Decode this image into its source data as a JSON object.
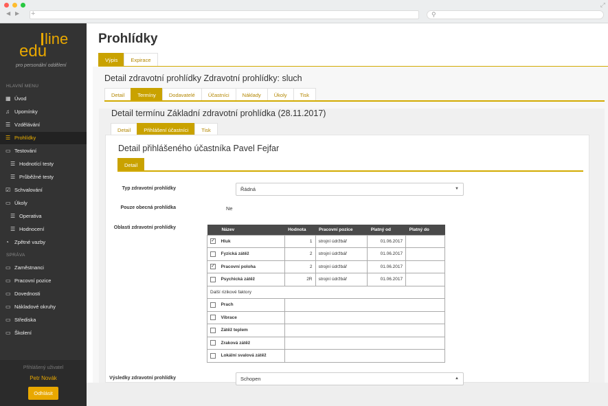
{
  "browser": {
    "nav_back": "◀",
    "nav_fwd": "▶",
    "new_tab": "+",
    "search_icon": "⚲",
    "expand_icon": "⤢"
  },
  "sidebar": {
    "logo_edu": "edu",
    "logo_line": "line",
    "tagline": "pro personální oddělení",
    "section_main": "HLAVNÍ MENU",
    "items": [
      {
        "label": "Úvod",
        "icon": "grid-icon",
        "glyph": "▦"
      },
      {
        "label": "Upomínky",
        "icon": "bell-icon",
        "glyph": "♫"
      },
      {
        "label": "Vzdělávání",
        "icon": "list-icon",
        "glyph": "☰"
      },
      {
        "label": "Prohlídky",
        "icon": "list-icon",
        "glyph": "☰",
        "active": true
      },
      {
        "label": "Testování",
        "icon": "folder-icon",
        "glyph": "▭"
      },
      {
        "label": "Hodnotící testy",
        "icon": "list-icon",
        "glyph": "☰",
        "sub": true
      },
      {
        "label": "Průběžné testy",
        "icon": "list-icon",
        "glyph": "☰",
        "sub": true
      },
      {
        "label": "Schvalování",
        "icon": "check-icon",
        "glyph": "☑"
      },
      {
        "label": "Úkoly",
        "icon": "folder-icon",
        "glyph": "▭"
      },
      {
        "label": "Operativa",
        "icon": "list-icon",
        "glyph": "☰",
        "sub": true
      },
      {
        "label": "Hodnocení",
        "icon": "list-icon",
        "glyph": "☰",
        "sub": true
      },
      {
        "label": "Zpětné vazby",
        "icon": "comment-icon",
        "glyph": "◔"
      }
    ],
    "section_admin": "SPRÁVA",
    "admin_items": [
      {
        "label": "Zaměstnanci",
        "icon": "folder-icon",
        "glyph": "▭"
      },
      {
        "label": "Pracovní pozice",
        "icon": "folder-icon",
        "glyph": "▭"
      },
      {
        "label": "Dovednosti",
        "icon": "folder-icon",
        "glyph": "▭"
      },
      {
        "label": "Nákladové okruhy",
        "icon": "folder-icon",
        "glyph": "▭"
      },
      {
        "label": "Střediska",
        "icon": "folder-icon",
        "glyph": "▭"
      },
      {
        "label": "Školení",
        "icon": "folder-icon",
        "glyph": "▭"
      }
    ],
    "user_caption": "Přihlášený uživatel",
    "user_name": "Petr Novák",
    "logout": "Odhlásit"
  },
  "page": {
    "title": "Prohlídky",
    "tabs1": [
      "Výpis",
      "Expirace"
    ],
    "detail_title": "Detail zdravotní prohlídky Zdravotní prohlídky: sluch",
    "tabs2": [
      "Detail",
      "Termíny",
      "Dodavatelé",
      "Účastníci",
      "Náklady",
      "Úkoly",
      "Tisk"
    ],
    "term_title": "Detail termínu Základní zdravotní prohlídka (28.11.2017)",
    "tabs3": [
      "Detail",
      "Přihlášení účastníci",
      "Tisk"
    ],
    "participant_title": "Detail přihlášeného účastníka Pavel Fejfar",
    "tabs4": [
      "Detail"
    ],
    "form": {
      "type_label": "Typ zdravotní prohlídky",
      "type_value": "Řádná",
      "general_label": "Pouze obecná prohlídka",
      "general_value": "Ne",
      "areas_label": "Oblasti zdravotní prohlídky",
      "results_label": "Výsledky zdravotní prohlídky",
      "results_value": "Schopen"
    },
    "table": {
      "headers": [
        "Název",
        "Hodnota",
        "Pracovní pozice",
        "Platný od",
        "Platný do"
      ],
      "rows": [
        {
          "checked": true,
          "name": "Hluk",
          "value": "1",
          "position": "strojní údržbář",
          "from": "01.06.2017",
          "to": ""
        },
        {
          "checked": false,
          "name": "Fyzická zátěž",
          "value": "2",
          "position": "strojní údržbář",
          "from": "01.06.2017",
          "to": ""
        },
        {
          "checked": true,
          "name": "Pracovní poloha",
          "value": "2",
          "position": "strojní údržbář",
          "from": "01.06.2017",
          "to": ""
        },
        {
          "checked": false,
          "name": "Psychická zátěž",
          "value": "2R",
          "position": "strojní údržbář",
          "from": "01.06.2017",
          "to": ""
        }
      ],
      "other_label": "Další rizikové faktory",
      "others": [
        {
          "checked": false,
          "name": "Prach"
        },
        {
          "checked": false,
          "name": "Vibrace"
        },
        {
          "checked": false,
          "name": "Zátěž teplem"
        },
        {
          "checked": false,
          "name": "Zraková zátěž"
        },
        {
          "checked": false,
          "name": "Lokální svalová zátěž"
        }
      ]
    }
  },
  "colors": {
    "accent": "#c9a200",
    "sidebar": "#333333"
  }
}
